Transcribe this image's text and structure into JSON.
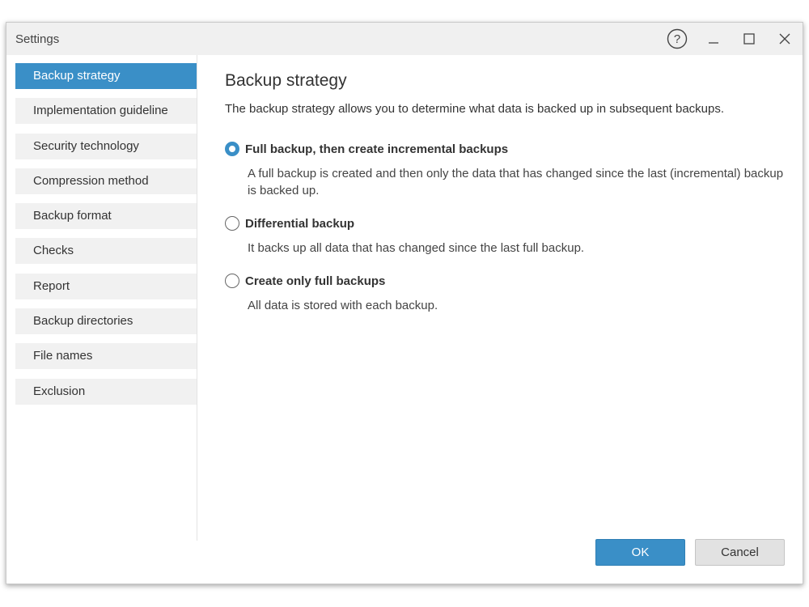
{
  "window": {
    "title": "Settings"
  },
  "sidebar": {
    "items": [
      {
        "label": "Backup strategy",
        "active": true
      },
      {
        "label": "Implementation guideline"
      },
      {
        "label": "Security technology"
      },
      {
        "label": "Compression method"
      },
      {
        "label": "Backup format"
      },
      {
        "label": "Checks"
      },
      {
        "label": "Report"
      },
      {
        "label": "Backup directories"
      },
      {
        "label": "File names"
      },
      {
        "label": "Exclusion"
      }
    ]
  },
  "main": {
    "heading": "Backup strategy",
    "description": "The backup strategy allows you to determine what data is backed up in subsequent backups.",
    "options": [
      {
        "label": "Full backup, then create incremental backups",
        "description": "A full backup is created and then only the data that has changed since the last (incremental) backup is backed up.",
        "selected": true
      },
      {
        "label": "Differential backup",
        "description": "It backs up all data that has changed since the last full backup.",
        "selected": false
      },
      {
        "label": "Create only full backups",
        "description": "All data is stored with each backup.",
        "selected": false
      }
    ]
  },
  "buttons": {
    "ok": "OK",
    "cancel": "Cancel"
  },
  "colors": {
    "accent": "#3a8fc7",
    "sidebar_bg": "#f1f1f1",
    "titlebar_bg": "#f0f0f0"
  },
  "icons": {
    "help": "help-icon",
    "minimize": "minimize-icon",
    "maximize": "maximize-icon",
    "close": "close-icon"
  }
}
